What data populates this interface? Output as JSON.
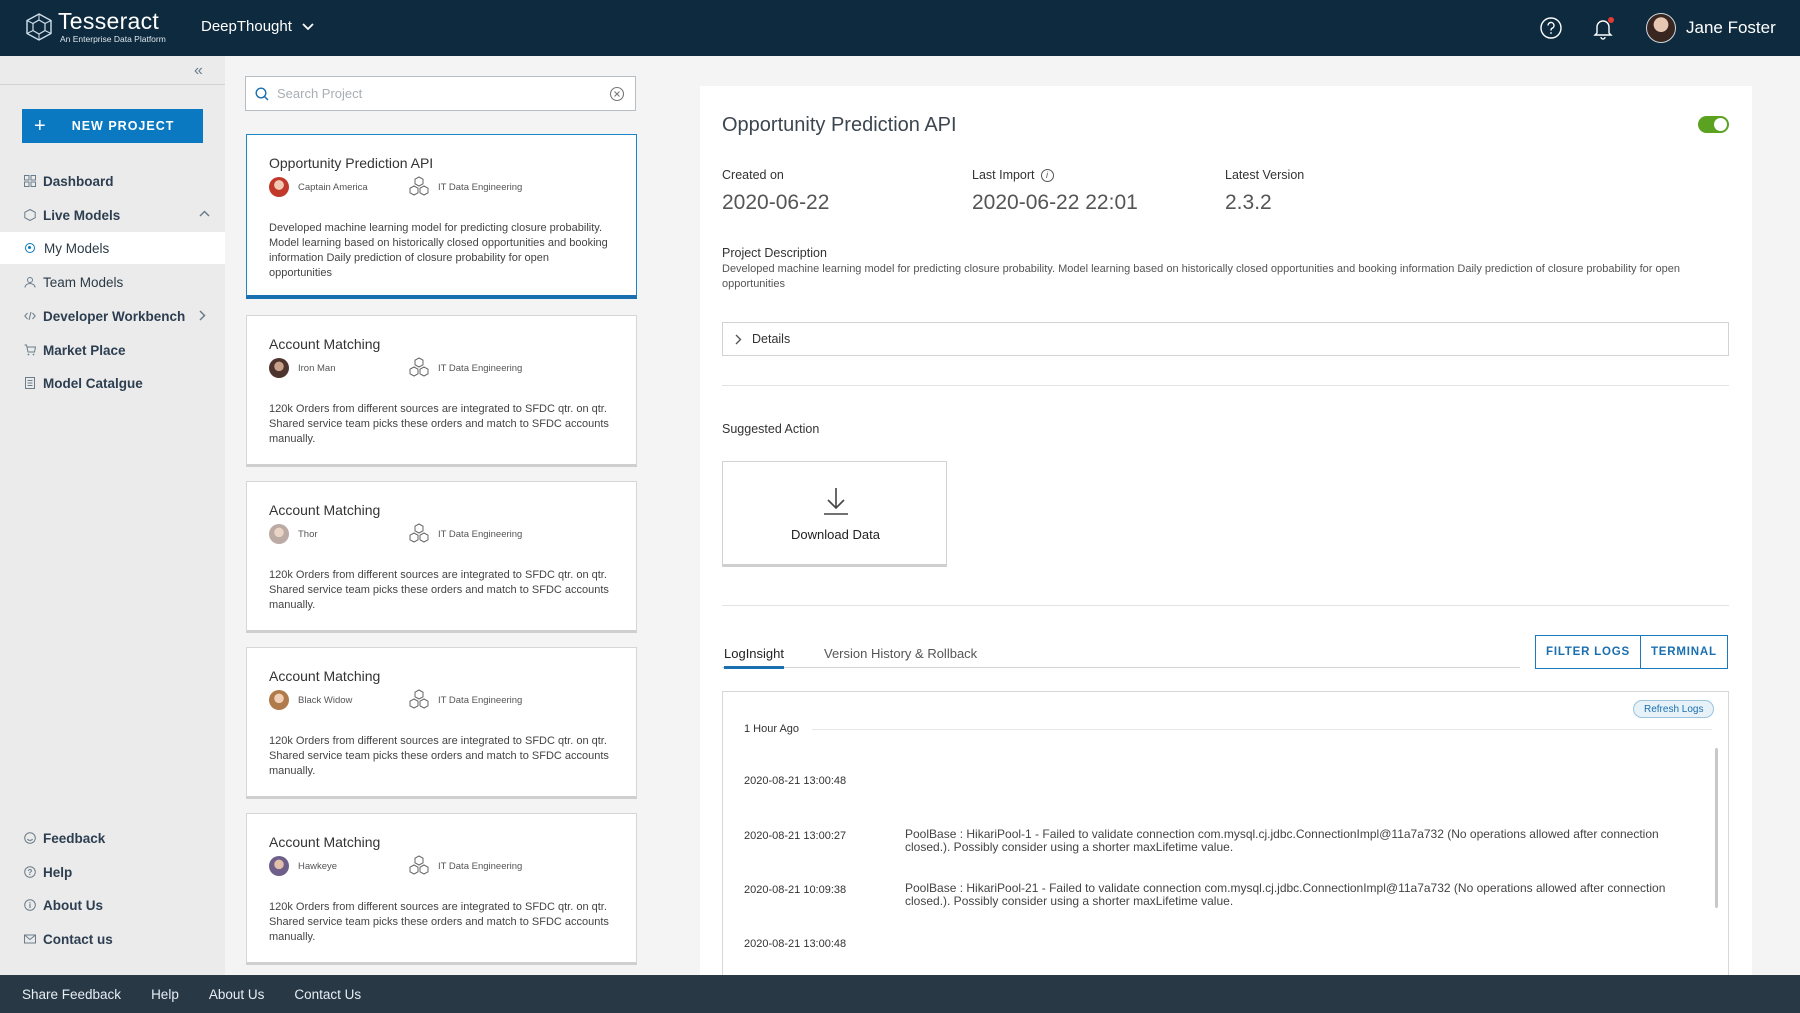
{
  "header": {
    "app_name": "Tesseract",
    "app_tagline": "An Enterprise Data Platform",
    "workspace": "DeepThought",
    "user_name": "Jane Foster"
  },
  "sidebar": {
    "new_project_label": "NEW PROJECT",
    "nav": [
      {
        "label": "Dashboard",
        "icon": "dashboard-icon"
      },
      {
        "label": "Live Models",
        "icon": "hexagon-icon"
      },
      {
        "label": "My Models",
        "icon": "radio-icon"
      },
      {
        "label": "Team Models",
        "icon": "team-icon"
      },
      {
        "label": "Developer Workbench",
        "icon": "code-icon"
      },
      {
        "label": "Market Place",
        "icon": "cart-icon"
      },
      {
        "label": "Model Catalgue",
        "icon": "catalogue-icon"
      }
    ],
    "bottom_nav": [
      {
        "label": "Feedback",
        "icon": "smile-icon"
      },
      {
        "label": "Help",
        "icon": "help-icon"
      },
      {
        "label": "About Us",
        "icon": "info-icon"
      },
      {
        "label": "Contact us",
        "icon": "mail-icon"
      }
    ]
  },
  "search": {
    "placeholder": "Search Project"
  },
  "projects": [
    {
      "title": "Opportunity Prediction API",
      "owner": "Captain America",
      "team": "IT Data Engineering",
      "description": "Developed machine learning model for predicting closure probability. Model learning based on historically closed opportunities and booking information Daily prediction of closure probability for open opportunities",
      "avatar_color": "#c0392b"
    },
    {
      "title": "Account Matching",
      "owner": "Iron Man",
      "team": "IT Data Engineering",
      "description": "120k Orders from different sources are integrated to SFDC qtr. on qtr. Shared service team picks these orders and match to SFDC accounts manually.",
      "avatar_color": "#5d4037"
    },
    {
      "title": "Account Matching",
      "owner": "Thor",
      "team": "IT Data Engineering",
      "description": "120k Orders from different sources are integrated to SFDC qtr. on qtr. Shared service team picks these orders and match to SFDC accounts manually.",
      "avatar_color": "#a1887f"
    },
    {
      "title": "Account Matching",
      "owner": "Black Widow",
      "team": "IT Data Engineering",
      "description": "120k Orders from different sources are integrated to SFDC qtr. on qtr. Shared service team picks these orders and match to SFDC accounts manually.",
      "avatar_color": "#b07a4a"
    },
    {
      "title": "Account Matching",
      "owner": "Hawkeye",
      "team": "IT Data Engineering",
      "description": "120k Orders from different sources are integrated to SFDC qtr. on qtr. Shared service team picks these orders and match to SFDC accounts manually.",
      "avatar_color": "#6d5f8a"
    }
  ],
  "detail": {
    "title": "Opportunity Prediction API",
    "enabled": true,
    "created_label": "Created on",
    "created_value": "2020-06-22",
    "import_label": "Last Import",
    "import_value": "2020-06-22 22:01",
    "version_label": "Latest Version",
    "version_value": "2.3.2",
    "desc_label": "Project Description",
    "desc_text": "Developed machine learning model for predicting closure probability. Model learning based on historically closed opportunities and booking information Daily prediction of closure probability for open opportunities",
    "details_label": "Details",
    "suggested_label": "Suggested Action",
    "download_label": "Download Data"
  },
  "tabs": {
    "loginsight": "LogInsight",
    "version_history": "Version History & Rollback",
    "filter_logs": "FILTER LOGS",
    "terminal": "TERMINAL"
  },
  "logs": {
    "refresh_label": "Refresh Logs",
    "group_label": "1 Hour Ago",
    "entries": [
      {
        "ts": "2020-08-21 13:00:48",
        "msg": ""
      },
      {
        "ts": "2020-08-21 13:00:27",
        "msg": "PoolBase : HikariPool-1 - Failed to validate connection com.mysql.cj.jdbc.ConnectionImpl@11a7a732 (No operations allowed after connection closed.). Possibly consider using a shorter maxLifetime value."
      },
      {
        "ts": "2020-08-21 10:09:38",
        "msg": "PoolBase : HikariPool-21 - Failed to validate connection com.mysql.cj.jdbc.ConnectionImpl@11a7a732 (No operations allowed after connection closed.). Possibly consider using a shorter maxLifetime value."
      },
      {
        "ts": "2020-08-21 13:00:48",
        "msg": ""
      }
    ]
  },
  "footer": {
    "links": [
      "Share Feedback",
      "Help",
      "About Us",
      "Contact Us"
    ]
  },
  "colors": {
    "header_bg": "#0e2a3e",
    "primary": "#0b79c1",
    "toggle_on": "#5aa220",
    "footer_bg": "#283845"
  }
}
